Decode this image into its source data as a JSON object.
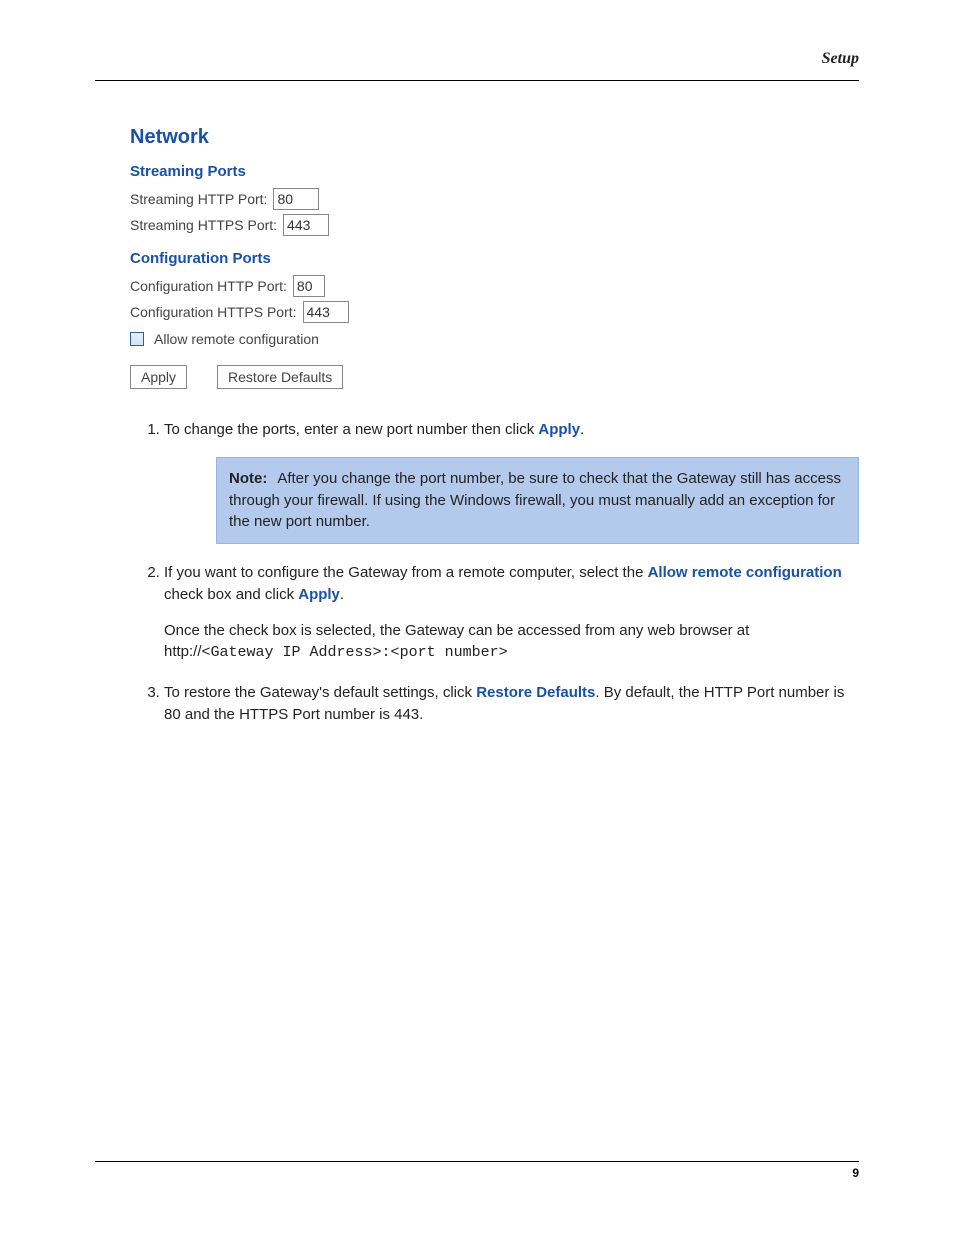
{
  "header": {
    "section": "Setup"
  },
  "panel": {
    "title": "Network",
    "streaming": {
      "heading": "Streaming Ports",
      "http_label": "Streaming HTTP Port:",
      "http_value": "80",
      "https_label": "Streaming HTTPS Port:",
      "https_value": "443"
    },
    "config": {
      "heading": "Configuration Ports",
      "http_label": "Configuration HTTP Port:",
      "http_value": "80",
      "https_label": "Configuration HTTPS Port:",
      "https_value": "443",
      "allow_remote_label": "Allow remote configuration"
    },
    "buttons": {
      "apply": "Apply",
      "restore": "Restore Defaults"
    }
  },
  "steps": {
    "s1_pre": "To change the ports, enter a new port number then click ",
    "s1_link": "Apply",
    "s1_post": ".",
    "note_label": "Note:",
    "note_body": "After you change the port number, be sure to check that the Gateway still has access through your firewall. If using the Windows firewall, you must manually add an exception for the new port number.",
    "s2_a": "If you want to configure the Gateway from a remote computer, select the ",
    "s2_link1": "Allow remote configuration",
    "s2_b": " check box and click ",
    "s2_link2": "Apply",
    "s2_c": ".",
    "s2_para2_a": "Once the check box is selected, the Gateway can be accessed from any web browser at http://",
    "s2_code": "<Gateway IP Address>:<port number>",
    "s3_a": "To restore the Gateway's default settings, click ",
    "s3_link": "Restore Defaults",
    "s3_b": ". By default, the HTTP Port number is 80 and the HTTPS Port number is 443."
  },
  "footer": {
    "page": "9"
  }
}
